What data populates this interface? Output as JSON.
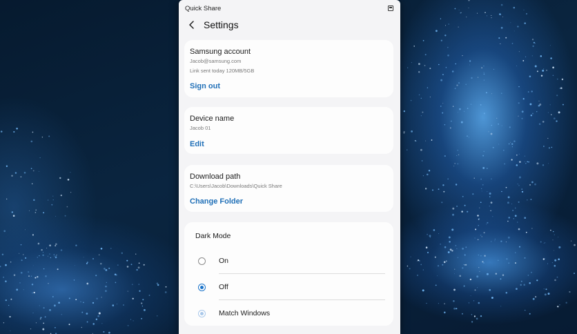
{
  "window": {
    "title": "Quick Share"
  },
  "header": {
    "title": "Settings"
  },
  "account": {
    "title": "Samsung account",
    "email": "Jacob@samsung.com",
    "status": "Link sent today 120MB/5GB",
    "action": "Sign out"
  },
  "device": {
    "title": "Device name",
    "name": "Jacob 01",
    "action": "Edit"
  },
  "download": {
    "title": "Download path",
    "path": "C:\\Users\\Jacob\\Downloads\\Quick Share",
    "action": "Change Folder"
  },
  "dark_mode": {
    "title": "Dark Mode",
    "options": [
      {
        "label": "On",
        "state": "unselected"
      },
      {
        "label": "Off",
        "state": "selected"
      },
      {
        "label": "Match Windows",
        "state": "disabled-selected"
      }
    ]
  },
  "icons": {
    "back": "chevron-left-icon",
    "pin": "pin-icon"
  },
  "colors": {
    "accent": "#1f6fb7",
    "radio_selected": "#1a73c9",
    "window_bg": "#f4f4f6"
  }
}
